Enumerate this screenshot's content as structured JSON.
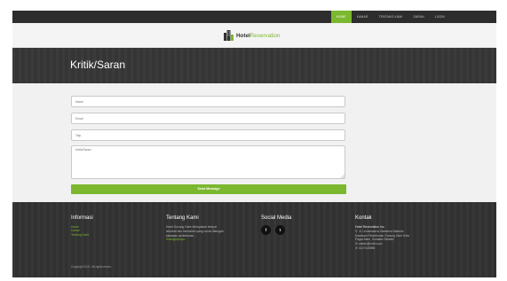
{
  "nav": {
    "items": [
      {
        "label": "HOME",
        "active": true
      },
      {
        "label": "KAMAR",
        "active": false
      },
      {
        "label": "TENTANG KAMI",
        "active": false
      },
      {
        "label": "SARAN",
        "active": false
      },
      {
        "label": "LOGIN",
        "active": false
      }
    ]
  },
  "brand": {
    "part1": "Hotel",
    "part2": "Reservation"
  },
  "hero": {
    "title": "Kritik/Saran"
  },
  "form": {
    "name_placeholder": "Name",
    "email_placeholder": "Email",
    "phone_placeholder": "Telp",
    "message_placeholder": "Kritik/Saran",
    "submit_label": "Send Message"
  },
  "footer": {
    "info": {
      "title": "Informasi",
      "links": [
        "Home",
        "Kamar",
        "Tentang Kami"
      ]
    },
    "about": {
      "title": "Tentang Kami",
      "lines": [
        "Hotel Gunung Gare Merupakan tempat",
        "istirahat dan bermalam yang cocok ditengah",
        "kawasan perkebunan ..."
      ],
      "more": "Selengkapnya"
    },
    "social": {
      "title": "Social Media",
      "facebook": "f",
      "twitter": "t"
    },
    "contact": {
      "title": "Kontak",
      "name": "Hotel Reservation Inc.",
      "address": [
        "Jl. Lemanwarno Markema Makedo",
        "Kawasan Perkebunan Gunung Gare Kota",
        "Pagar Alam, Sumatra Selatan."
      ],
      "email": "admin@hotel.com",
      "phone": "0127445555"
    },
    "copyright": "Copyright 2021. All rights reserv."
  },
  "colors": {
    "accent": "#7cb82f",
    "topbar": "#2d2d2d",
    "footer": "#333333"
  }
}
